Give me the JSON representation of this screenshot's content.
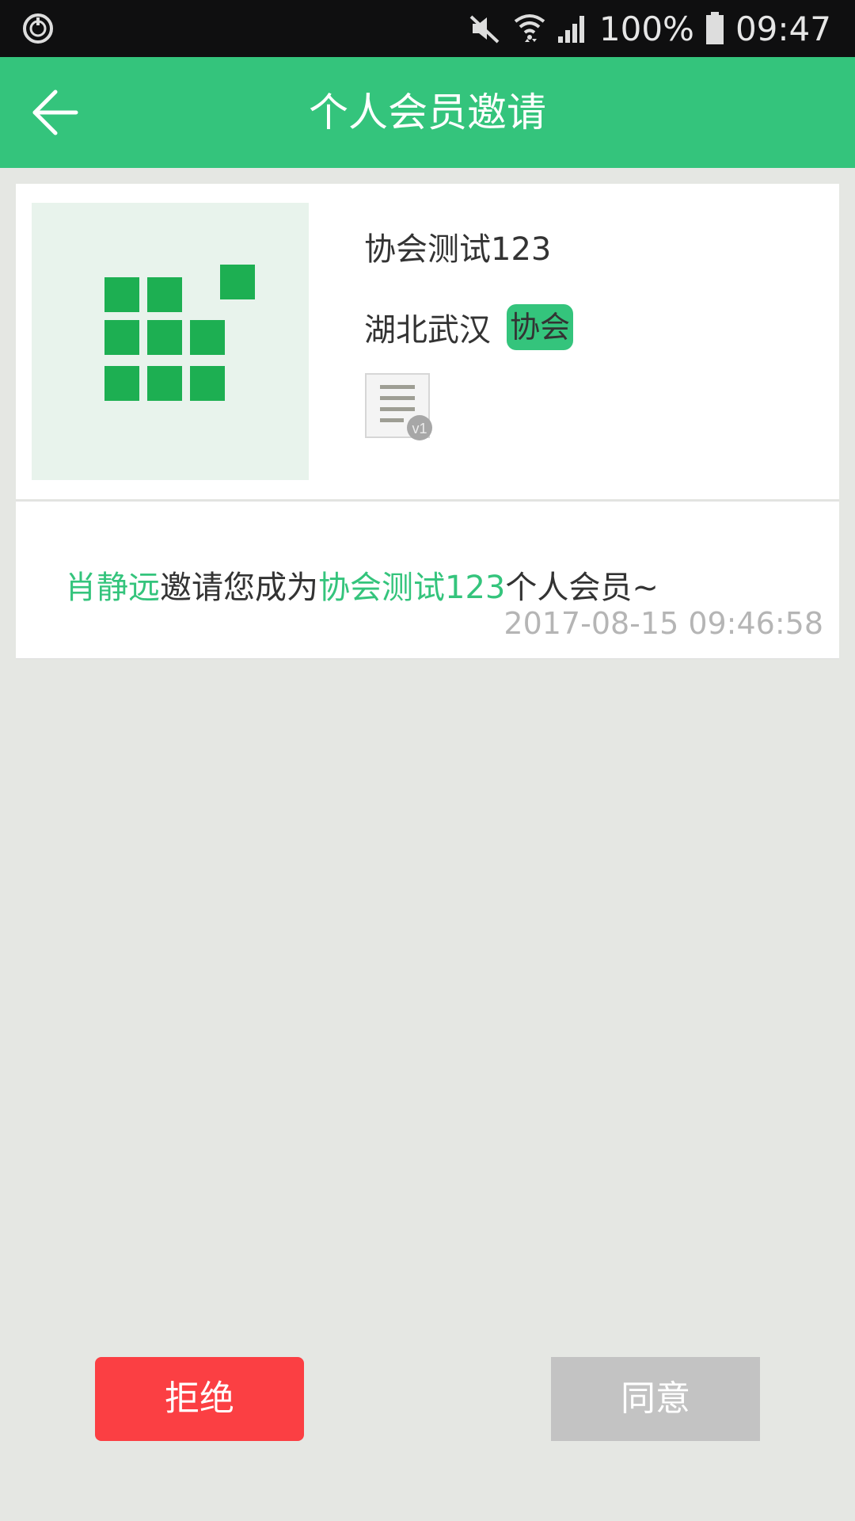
{
  "status_bar": {
    "battery": "100%",
    "time": "09:47",
    "icons": [
      "sync-icon",
      "mute-icon",
      "wifi-icon",
      "signal-icon",
      "battery-icon"
    ]
  },
  "header": {
    "title": "个人会员邀请",
    "back_icon": "back-arrow-icon",
    "background": "#34c47c"
  },
  "org": {
    "name": "协会测试123",
    "region": "湖北武汉",
    "type_tag": "协会",
    "doc_badge": "v1"
  },
  "invitation": {
    "inviter": "肖静远",
    "text_1": "邀请您成为",
    "org_name": "协会测试123",
    "text_2": "个人会员~",
    "timestamp": "2017-08-15 09:46:58"
  },
  "actions": {
    "reject_label": "拒绝",
    "accept_label": "同意",
    "reject_color": "#fb3f43",
    "accept_color": "#c3c3c3"
  },
  "colors": {
    "accent": "#34c47c",
    "logo_green": "#1daf52",
    "page_bg": "#e5e7e3"
  }
}
